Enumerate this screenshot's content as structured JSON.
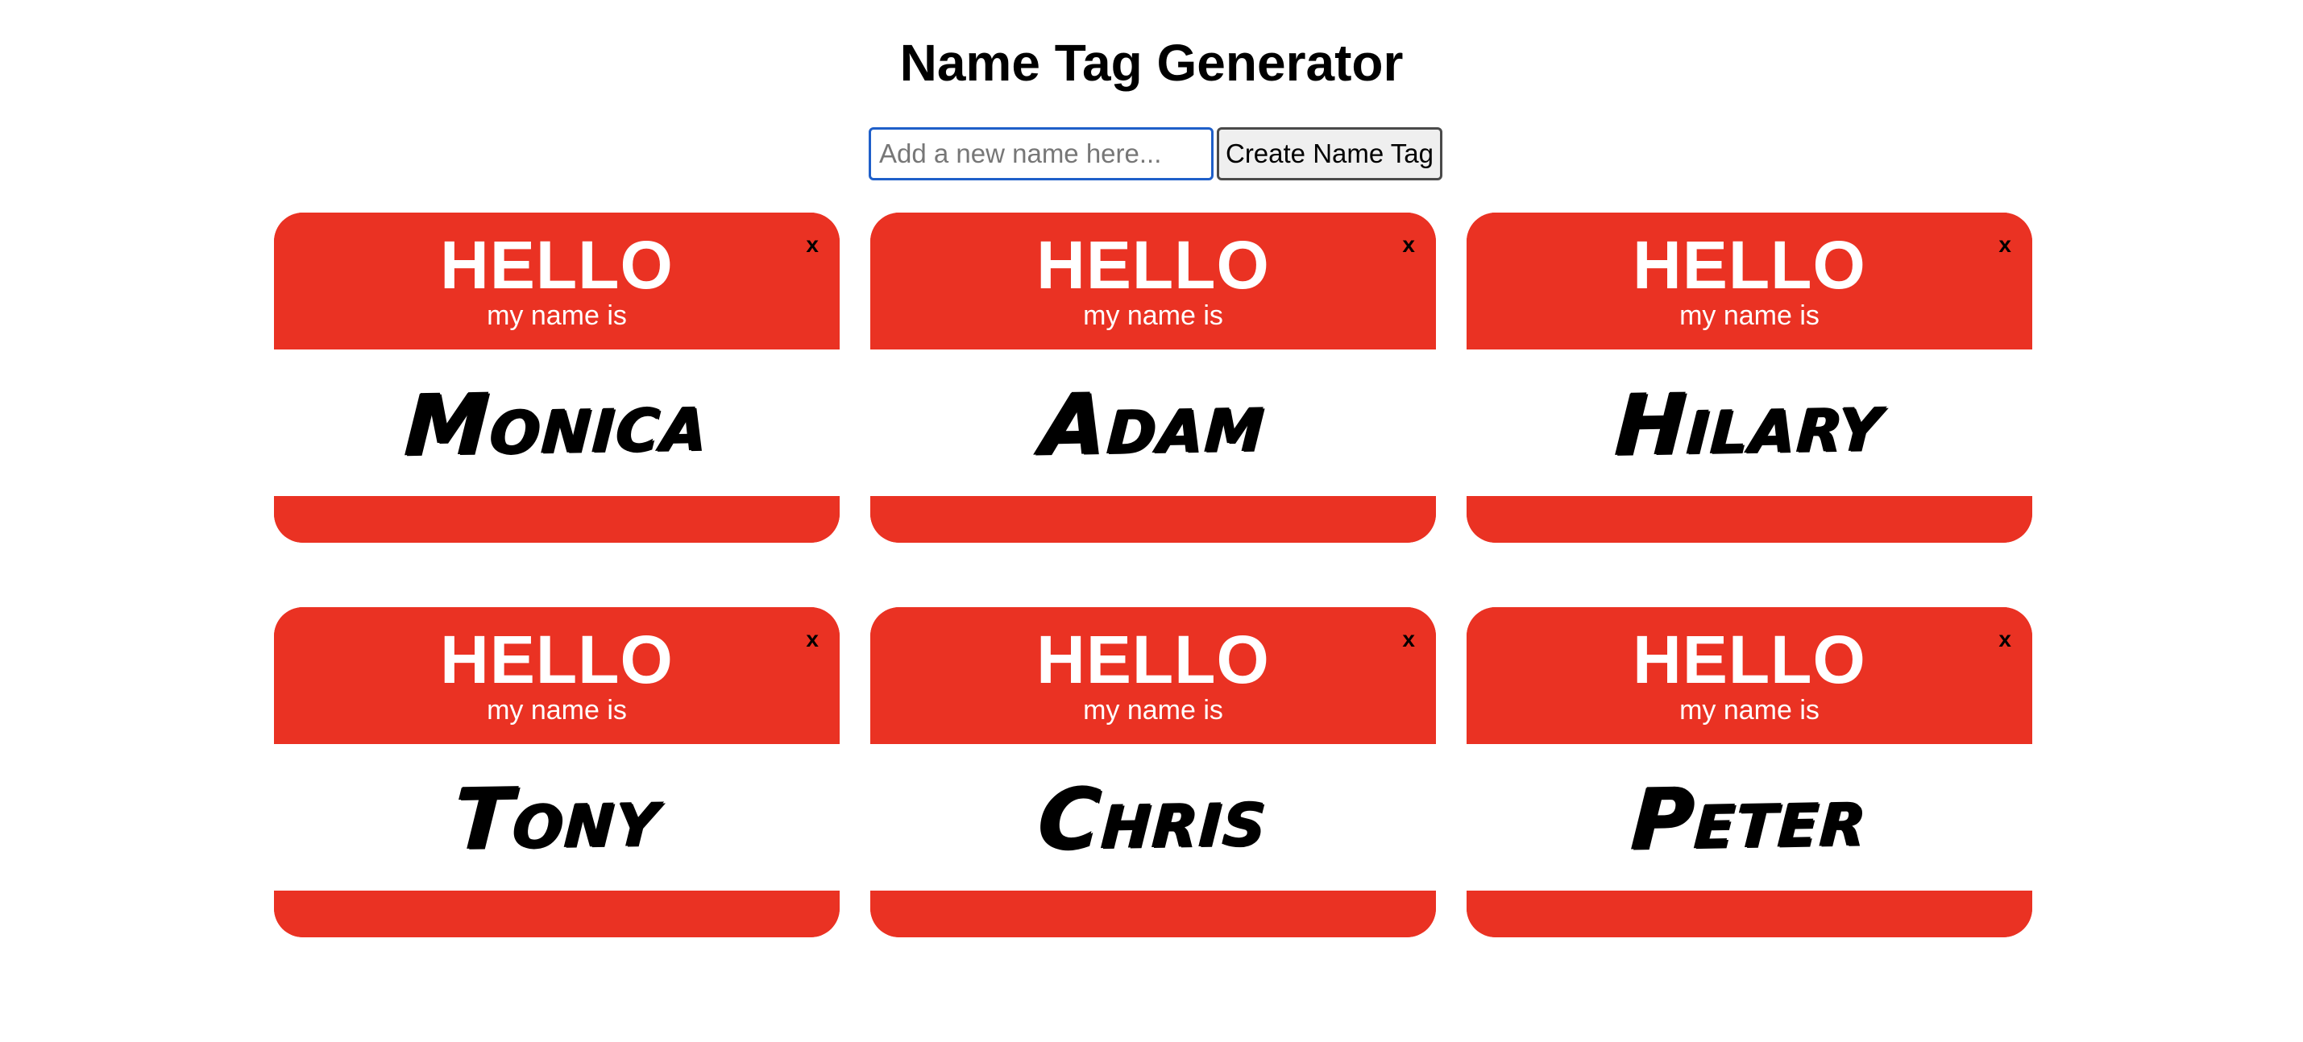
{
  "page": {
    "title": "Name Tag Generator"
  },
  "form": {
    "input_placeholder": "Add a new name here...",
    "input_value": "",
    "button_label": "Create Name Tag"
  },
  "tag_template": {
    "hello": "HELLO",
    "subtitle": "my name is",
    "close_label": "x"
  },
  "colors": {
    "tag_red": "#ea3223",
    "input_focus_border": "#1f5fc9"
  },
  "tags": [
    {
      "name": "Monica"
    },
    {
      "name": "Adam"
    },
    {
      "name": "Hilary"
    },
    {
      "name": "Tony"
    },
    {
      "name": "Chris"
    },
    {
      "name": "Peter"
    }
  ]
}
